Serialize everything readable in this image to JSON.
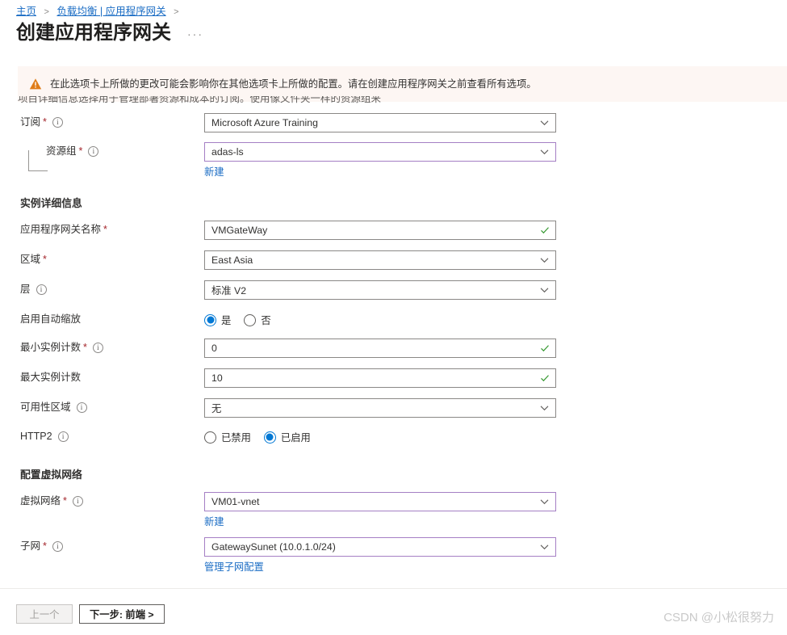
{
  "breadcrumb": {
    "home": "主页",
    "sep1": ">",
    "section": "负载均衡 | 应用程序网关",
    "sep2": ">"
  },
  "header": {
    "title": "创建应用程序网关",
    "more_menu": "···"
  },
  "banner": {
    "icon": "warning-triangle-icon",
    "text": "在此选项卡上所做的更改可能会影响你在其他选项卡上所做的配置。请在创建应用程序网关之前查看所有选项。",
    "background": "#fdf6f3",
    "icon_color": "#d8741c"
  },
  "clipped_row": {
    "text": "项目详细信息选择用于管理部署资源和成本的订阅。使用像文件夹一样的资源组来组织和管理所有资源。"
  },
  "form": {
    "subscription": {
      "label": "订阅",
      "required": "*",
      "info": "i",
      "value": "Microsoft Azure Training"
    },
    "resource_group": {
      "label": "资源组",
      "required": "*",
      "info": "i",
      "value": "adas-ls",
      "create_new": "新建"
    },
    "instance_details_heading": "实例详细信息",
    "gateway_name": {
      "label": "应用程序网关名称",
      "required": "*",
      "value": "VMGateWay"
    },
    "region": {
      "label": "区域",
      "required": "*",
      "value": "East Asia"
    },
    "tier": {
      "label": "层",
      "info": "i",
      "value": "标准 V2"
    },
    "autoscale": {
      "label": "启用自动缩放",
      "options": [
        "是",
        "否"
      ],
      "selected": "是"
    },
    "min_instances": {
      "label": "最小实例计数",
      "required": "*",
      "info": "i",
      "value": "0"
    },
    "max_instances": {
      "label": "最大实例计数",
      "value": "10"
    },
    "availability_zone": {
      "label": "可用性区域",
      "info": "i",
      "value": "无"
    },
    "http2": {
      "label": "HTTP2",
      "info": "i",
      "options": [
        "已禁用",
        "已启用"
      ],
      "selected": "已启用"
    },
    "vnet_heading": "配置虚拟网络",
    "virtual_network": {
      "label": "虚拟网络",
      "required": "*",
      "info": "i",
      "value": "VM01-vnet",
      "create_new": "新建"
    },
    "subnet": {
      "label": "子网",
      "required": "*",
      "info": "i",
      "value": "GatewaySunet (10.0.1.0/24)",
      "manage_link": "管理子网配置"
    }
  },
  "footer": {
    "previous": "上一个",
    "next": "下一步: 前端 >"
  },
  "watermark": "CSDN @小松很努力",
  "colors": {
    "link": "#1a6cc4",
    "accent": "#0078d4",
    "purple_border": "#a57fc4",
    "required_star": "#a4262c",
    "valid_check": "#3a9b35"
  }
}
